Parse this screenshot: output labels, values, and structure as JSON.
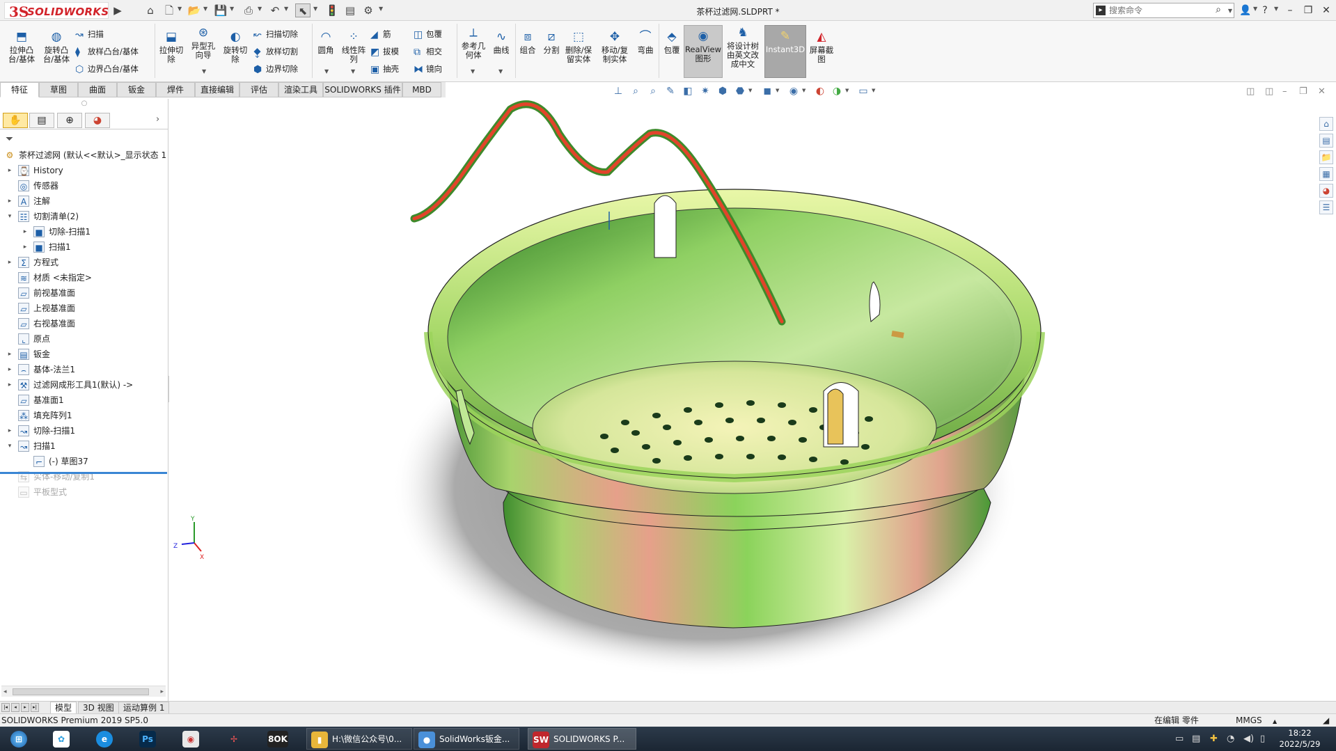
{
  "app": {
    "brand_ds": "3S",
    "brand_name": "SOLIDWORKS",
    "title": "茶杯过滤网.SLDPRT *"
  },
  "search": {
    "placeholder": "搜索命令"
  },
  "ribbon": {
    "buttons": [
      {
        "id": "extrude-boss",
        "label1": "拉伸凸",
        "label2": "台/基体"
      },
      {
        "id": "revolve-boss",
        "label1": "旋转凸",
        "label2": "台/基体"
      },
      {
        "id": "extrude-cut",
        "label1": "拉伸切",
        "label2": "除"
      },
      {
        "id": "hole-wizard",
        "label1": "异型孔",
        "label2": "向导"
      },
      {
        "id": "revolve-cut",
        "label1": "旋转切",
        "label2": "除"
      },
      {
        "id": "fillet",
        "label1": "圆角",
        "label2": ""
      },
      {
        "id": "linear-pattern",
        "label1": "线性阵",
        "label2": "列"
      },
      {
        "id": "ref-geometry",
        "label1": "参考几",
        "label2": "何体"
      },
      {
        "id": "curves",
        "label1": "曲线",
        "label2": ""
      },
      {
        "id": "combine",
        "label1": "组合",
        "label2": ""
      },
      {
        "id": "split",
        "label1": "分割",
        "label2": ""
      },
      {
        "id": "delete-keep",
        "label1": "删除/保",
        "label2": "留实体"
      },
      {
        "id": "move-copy",
        "label1": "移动/复",
        "label2": "制实体"
      },
      {
        "id": "flex",
        "label1": "弯曲",
        "label2": ""
      },
      {
        "id": "wrap2",
        "label1": "包覆",
        "label2": ""
      },
      {
        "id": "realview",
        "label1": "RealView",
        "label2": "图形"
      },
      {
        "id": "translate-tree",
        "label1": "将设计树",
        "label2": "由英文改",
        "label3": "成中文"
      },
      {
        "id": "instant3d",
        "label1": "Instant3D",
        "label2": ""
      },
      {
        "id": "screenshot",
        "label1": "屏幕截",
        "label2": "图"
      }
    ],
    "small": {
      "sweep": "扫描",
      "loft": "放样凸台/基体",
      "boundary": "边界凸台/基体",
      "swept-cut": "扫描切除",
      "lofted-cut": "放样切割",
      "boundary-cut": "边界切除",
      "rib": "筋",
      "draft": "拔模",
      "shell": "抽壳",
      "wrap": "包覆",
      "intersect": "相交",
      "mirror": "镜向"
    }
  },
  "tabs": [
    "特征",
    "草图",
    "曲面",
    "钣金",
    "焊件",
    "直接编辑",
    "评估",
    "渲染工具",
    "SOLIDWORKS 插件",
    "MBD"
  ],
  "tree": {
    "root": "茶杯过滤网  (默认<<默认>_显示状态 1",
    "items": [
      {
        "label": "History",
        "expand": "▸",
        "indent": 0,
        "icon": "history-icon",
        "glyph": "⌚"
      },
      {
        "label": "传感器",
        "expand": "",
        "indent": 0,
        "icon": "sensor-icon",
        "glyph": "◎"
      },
      {
        "label": "注解",
        "expand": "▸",
        "indent": 0,
        "icon": "annotation-icon",
        "glyph": "A"
      },
      {
        "label": "切割清单(2)",
        "expand": "▾",
        "indent": 0,
        "icon": "cutlist-icon",
        "glyph": "☷"
      },
      {
        "label": "切除-扫描1",
        "expand": "▸",
        "indent": 1,
        "icon": "solid-body-icon",
        "glyph": "■"
      },
      {
        "label": "扫描1",
        "expand": "▸",
        "indent": 1,
        "icon": "solid-body-icon",
        "glyph": "■"
      },
      {
        "label": "方程式",
        "expand": "▸",
        "indent": 0,
        "icon": "equation-icon",
        "glyph": "Σ"
      },
      {
        "label": "材质 <未指定>",
        "expand": "",
        "indent": 0,
        "icon": "material-icon",
        "glyph": "≋"
      },
      {
        "label": "前视基准面",
        "expand": "",
        "indent": 0,
        "icon": "plane-icon",
        "glyph": "▱"
      },
      {
        "label": "上视基准面",
        "expand": "",
        "indent": 0,
        "icon": "plane-icon",
        "glyph": "▱"
      },
      {
        "label": "右视基准面",
        "expand": "",
        "indent": 0,
        "icon": "plane-icon",
        "glyph": "▱"
      },
      {
        "label": "原点",
        "expand": "",
        "indent": 0,
        "icon": "origin-icon",
        "glyph": "⌞"
      },
      {
        "label": "钣金",
        "expand": "▸",
        "indent": 0,
        "icon": "sheetmetal-icon",
        "glyph": "▤"
      },
      {
        "label": "基体-法兰1",
        "expand": "▸",
        "indent": 0,
        "icon": "base-flange-icon",
        "glyph": "⌢"
      },
      {
        "label": "过滤网成形工具1(默认) ->",
        "expand": "▸",
        "indent": 0,
        "icon": "forming-tool-icon",
        "glyph": "⚒"
      },
      {
        "label": "基准面1",
        "expand": "",
        "indent": 0,
        "icon": "plane-icon",
        "glyph": "▱"
      },
      {
        "label": "填充阵列1",
        "expand": "",
        "indent": 0,
        "icon": "fill-pattern-icon",
        "glyph": "⁂"
      },
      {
        "label": "切除-扫描1",
        "expand": "▸",
        "indent": 0,
        "icon": "swept-cut-icon",
        "glyph": "↝"
      },
      {
        "label": "扫描1",
        "expand": "▾",
        "indent": 0,
        "icon": "sweep-icon",
        "glyph": "↝"
      },
      {
        "label": "(-) 草图37",
        "expand": "",
        "indent": 1,
        "icon": "sketch-icon",
        "glyph": "⌐"
      },
      {
        "label": "实体-移动/复制1",
        "expand": "",
        "indent": 0,
        "icon": "move-body-icon",
        "glyph": "⇆",
        "dim": true
      },
      {
        "label": "平板型式",
        "expand": "",
        "indent": 0,
        "icon": "flat-pattern-icon",
        "glyph": "▭",
        "dim": true
      }
    ]
  },
  "model_tabs": [
    "模型",
    "3D 视图",
    "运动算例 1"
  ],
  "status": {
    "product": "SOLIDWORKS Premium 2019 SP5.0",
    "editing": "在编辑  零件",
    "units": "MMGS"
  },
  "taskbar": {
    "apps": [
      {
        "id": "explorer",
        "label": "H:\\微信公众号\\0...",
        "color": "#e8b63a",
        "glyph": "▮"
      },
      {
        "id": "chrome",
        "label": "SolidWorks钣金...",
        "color": "#4a90d9",
        "glyph": "●"
      },
      {
        "id": "solidworks",
        "label": "SOLIDWORKS P...",
        "color": "#c0272d",
        "glyph": "SW"
      }
    ],
    "time": "18:22",
    "date": "2022/5/29"
  },
  "triad": {
    "x": "X",
    "y": "Y",
    "z": "Z"
  },
  "colors": {
    "accent": "#1d5fa7",
    "sw_red": "#d2232a",
    "body_green": "#7fd35a",
    "handle_red": "#e2442a"
  }
}
